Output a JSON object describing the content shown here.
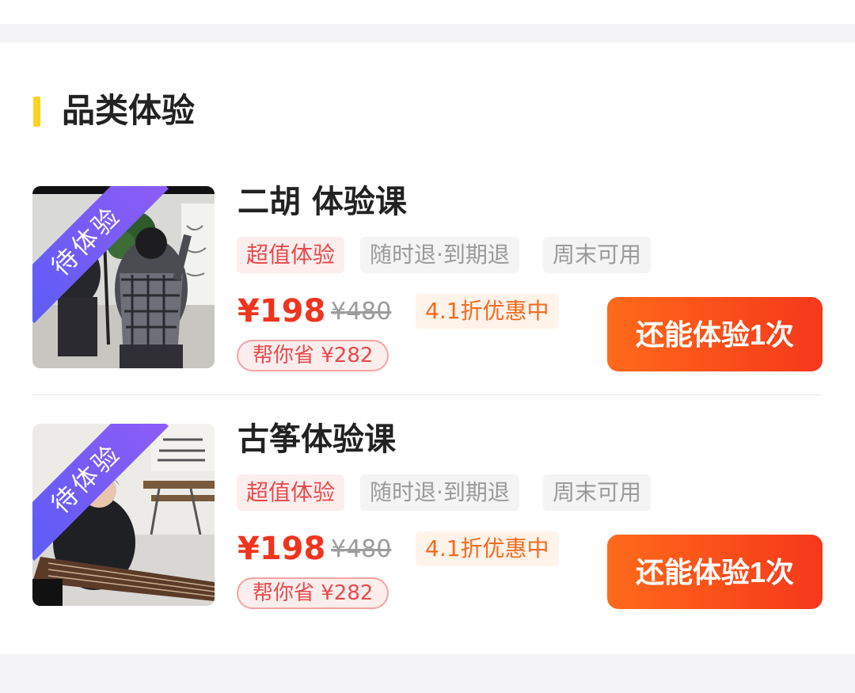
{
  "section": {
    "title": "品类体验"
  },
  "courses": [
    {
      "title": "二胡 体验课",
      "badge": "待体验",
      "tags": [
        "超值体验",
        "随时退·到期退",
        "周末可用"
      ],
      "price": "¥198",
      "original_price": "¥480",
      "discount": "4.1折优惠中",
      "saving": "帮你省 ¥282",
      "cta": "还能体验1次"
    },
    {
      "title": "古筝体验课",
      "badge": "待体验",
      "tags": [
        "超值体验",
        "随时退·到期退",
        "周末可用"
      ],
      "price": "¥198",
      "original_price": "¥480",
      "discount": "4.1折优惠中",
      "saving": "帮你省 ¥282",
      "cta": "还能体验1次"
    }
  ],
  "colors": {
    "accent_bar": "#ffd21f",
    "price": "#f0341e",
    "cta_start": "#ff6a1a",
    "cta_end": "#f5381b",
    "badge_start": "#5d5cf6",
    "badge_end": "#8d5cf6"
  }
}
